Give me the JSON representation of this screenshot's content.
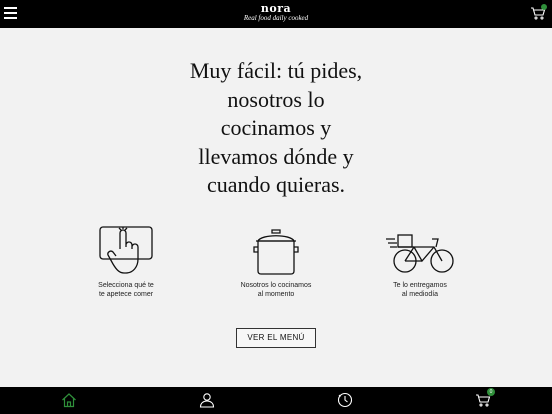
{
  "header": {
    "brand_name": "nora",
    "brand_tagline": "Real food daily cooked",
    "menu_icon": "hamburger-icon",
    "cart_icon": "shopping-cart-icon"
  },
  "hero": {
    "lines": [
      "Muy fácil: tú pides,",
      "nosotros lo",
      "cocinamos y",
      "llevamos dónde y",
      "cuando quieras."
    ]
  },
  "steps": [
    {
      "icon": "touch-screen-hand-icon",
      "label_lines": [
        "Selecciona qué te",
        "te apetece comer"
      ]
    },
    {
      "icon": "cooking-pot-icon",
      "label_lines": [
        "Nosotros lo cocinamos",
        "al momento"
      ]
    },
    {
      "icon": "delivery-bike-icon",
      "label_lines": [
        "Te lo entregamos",
        "al mediodía"
      ]
    }
  ],
  "cta": {
    "label": "VER EL MENÚ"
  },
  "tabbar": {
    "tabs": [
      {
        "icon": "home-icon",
        "active": true
      },
      {
        "icon": "user-icon",
        "active": false
      },
      {
        "icon": "clock-icon",
        "active": false
      },
      {
        "icon": "cart-icon",
        "active": false,
        "badge": "0"
      }
    ]
  },
  "colors": {
    "bar": "#000000",
    "background": "#f2f2f2",
    "accent": "#2f8f3a"
  }
}
